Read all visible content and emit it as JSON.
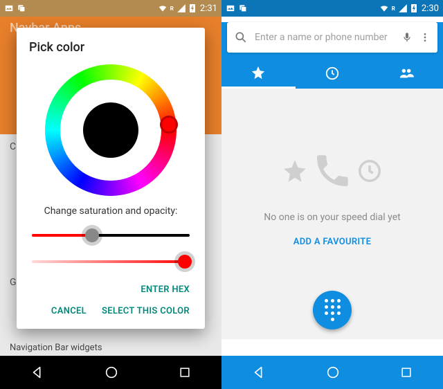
{
  "left": {
    "status": {
      "time": "2:31"
    },
    "background": {
      "title": "Navbar Apps",
      "row_c": "C",
      "row_g": "G",
      "nav_widgets": "Navigation Bar widgets"
    },
    "dialog": {
      "title": "Pick color",
      "swatch_color": "#000000",
      "hue_handle_color": "#ff0000",
      "slider_label": "Change saturation and opacity:",
      "saturation": 0.38,
      "opacity": 1.0,
      "enter_hex": "ENTER HEX",
      "cancel": "CANCEL",
      "select": "SELECT THIS COLOR"
    }
  },
  "right": {
    "status": {
      "time": "2:30"
    },
    "search": {
      "placeholder": "Enter a name or phone number"
    },
    "tabs": {
      "favorites": "favorites",
      "recents": "recents",
      "contacts": "contacts",
      "active": "favorites"
    },
    "empty": {
      "message": "No one is on your speed dial yet",
      "add_label": "ADD A FAVOURITE"
    }
  },
  "colors": {
    "accent_teal": "#00897b",
    "dialer_blue": "#0f8de0"
  }
}
